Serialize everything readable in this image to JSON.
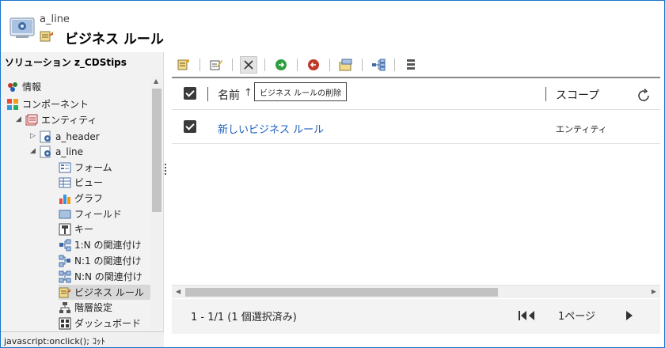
{
  "header": {
    "entity_name": "a_line",
    "page_title": "ビジネス ルール"
  },
  "nav": {
    "solution_title": "ソリューション z_CDStips",
    "items": [
      {
        "label": "情報",
        "icon": "info-icon"
      },
      {
        "label": "コンポーネント",
        "icon": "components-icon"
      },
      {
        "label": "エンティティ",
        "icon": "entities-icon"
      },
      {
        "label": "a_header",
        "icon": "entity-icon"
      },
      {
        "label": "a_line",
        "icon": "entity-icon"
      },
      {
        "label": "フォーム",
        "icon": "form-icon"
      },
      {
        "label": "ビュー",
        "icon": "view-icon"
      },
      {
        "label": "グラフ",
        "icon": "chart-icon"
      },
      {
        "label": "フィールド",
        "icon": "field-icon"
      },
      {
        "label": "キー",
        "icon": "key-icon"
      },
      {
        "label": "1:N の関連付け",
        "icon": "relationship-icon"
      },
      {
        "label": "N:1 の関連付け",
        "icon": "relationship-icon"
      },
      {
        "label": "N:N の関連付け",
        "icon": "relationship-icon"
      },
      {
        "label": "ビジネス ルール",
        "icon": "business-rule-icon"
      },
      {
        "label": "階層設定",
        "icon": "hierarchy-icon"
      },
      {
        "label": "ダッシュボード",
        "icon": "dashboard-icon"
      }
    ],
    "selected_item": "ビジネス ルール"
  },
  "status_bar": {
    "text": "javascript:onclick(); ｺｯﾄ"
  },
  "toolbar": {
    "tooltip": "ビジネス ルールの削除"
  },
  "grid": {
    "columns": {
      "name": "名前",
      "sort_arrow": "↑",
      "scope": "スコープ"
    },
    "rows": [
      {
        "name": "新しいビジネス ルール",
        "scope": "エンティティ",
        "checked": true
      }
    ]
  },
  "footer": {
    "record_count": "1 - 1/1 (1 個選択済み)",
    "page_label": "1ページ"
  },
  "colors": {
    "link": "#1f5fbf",
    "window_border": "#1a73c8"
  }
}
